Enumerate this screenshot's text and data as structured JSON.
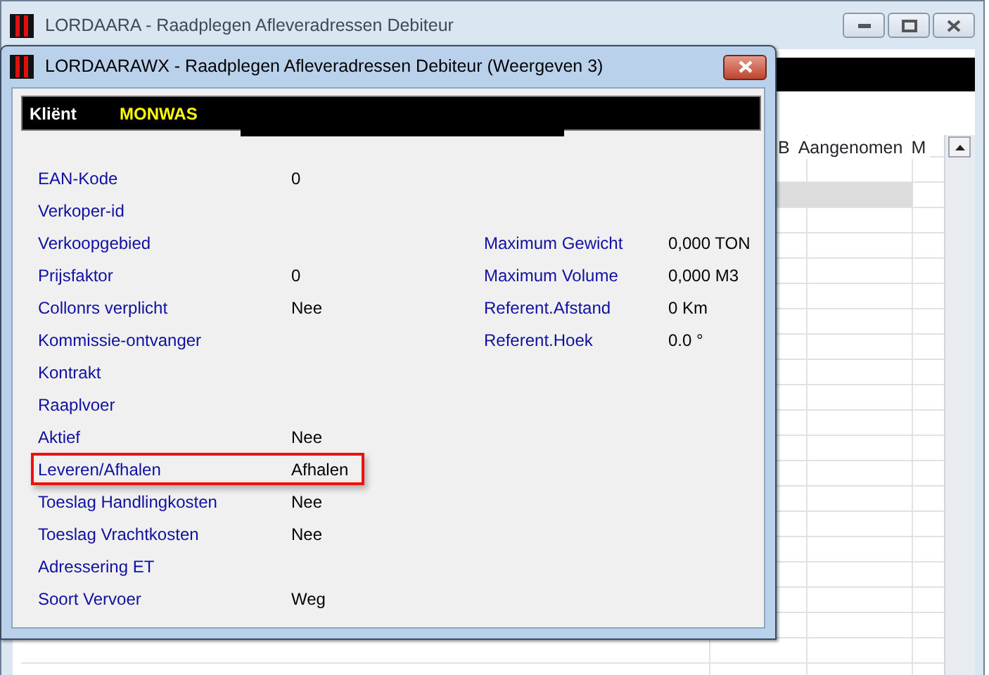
{
  "back_window": {
    "title": "LORDAARA - Raadplegen Afleveradressen Debiteur",
    "grid_columns": [
      "B",
      "Aangenomen",
      "M"
    ]
  },
  "dialog": {
    "title": "LORDAARAWX - Raadplegen Afleveradressen Debiteur (Weergeven 3)",
    "client_label": "Kliënt",
    "client_value": "MONWAS",
    "left_fields": [
      {
        "label": "EAN-Kode",
        "value": "0",
        "highlighted": false
      },
      {
        "label": "Verkoper-id",
        "highlighted": false
      },
      {
        "label": "Verkoopgebied",
        "highlighted": false
      },
      {
        "label": "Prijsfaktor",
        "value": "0",
        "highlighted": false
      },
      {
        "label": "Collonrs verplicht",
        "value": "Nee",
        "highlighted": false
      },
      {
        "label": "Kommissie-ontvanger",
        "highlighted": false
      },
      {
        "label": "Kontrakt",
        "highlighted": false
      },
      {
        "label": "Raaplvoer",
        "highlighted": false
      },
      {
        "label": "Aktief",
        "value": "Nee",
        "highlighted": false
      },
      {
        "label": "Leveren/Afhalen",
        "value": "Afhalen",
        "highlighted": true
      },
      {
        "label": "Toeslag Handlingkosten",
        "value": "Nee",
        "highlighted": false
      },
      {
        "label": "Toeslag Vrachtkosten",
        "value": "Nee",
        "highlighted": false
      },
      {
        "label": "Adressering ET",
        "highlighted": false
      },
      {
        "label": "Soort Vervoer",
        "value": "Weg",
        "highlighted": false
      }
    ],
    "right_fields": [
      {
        "label": "Maximum Gewicht",
        "value": "0,000 TON"
      },
      {
        "label": "Maximum Volume",
        "value": "0,000 M3"
      },
      {
        "label": "Referent.Afstand",
        "value": "0 Km"
      },
      {
        "label": "Referent.Hoek",
        "value": "0.0 °"
      }
    ]
  }
}
